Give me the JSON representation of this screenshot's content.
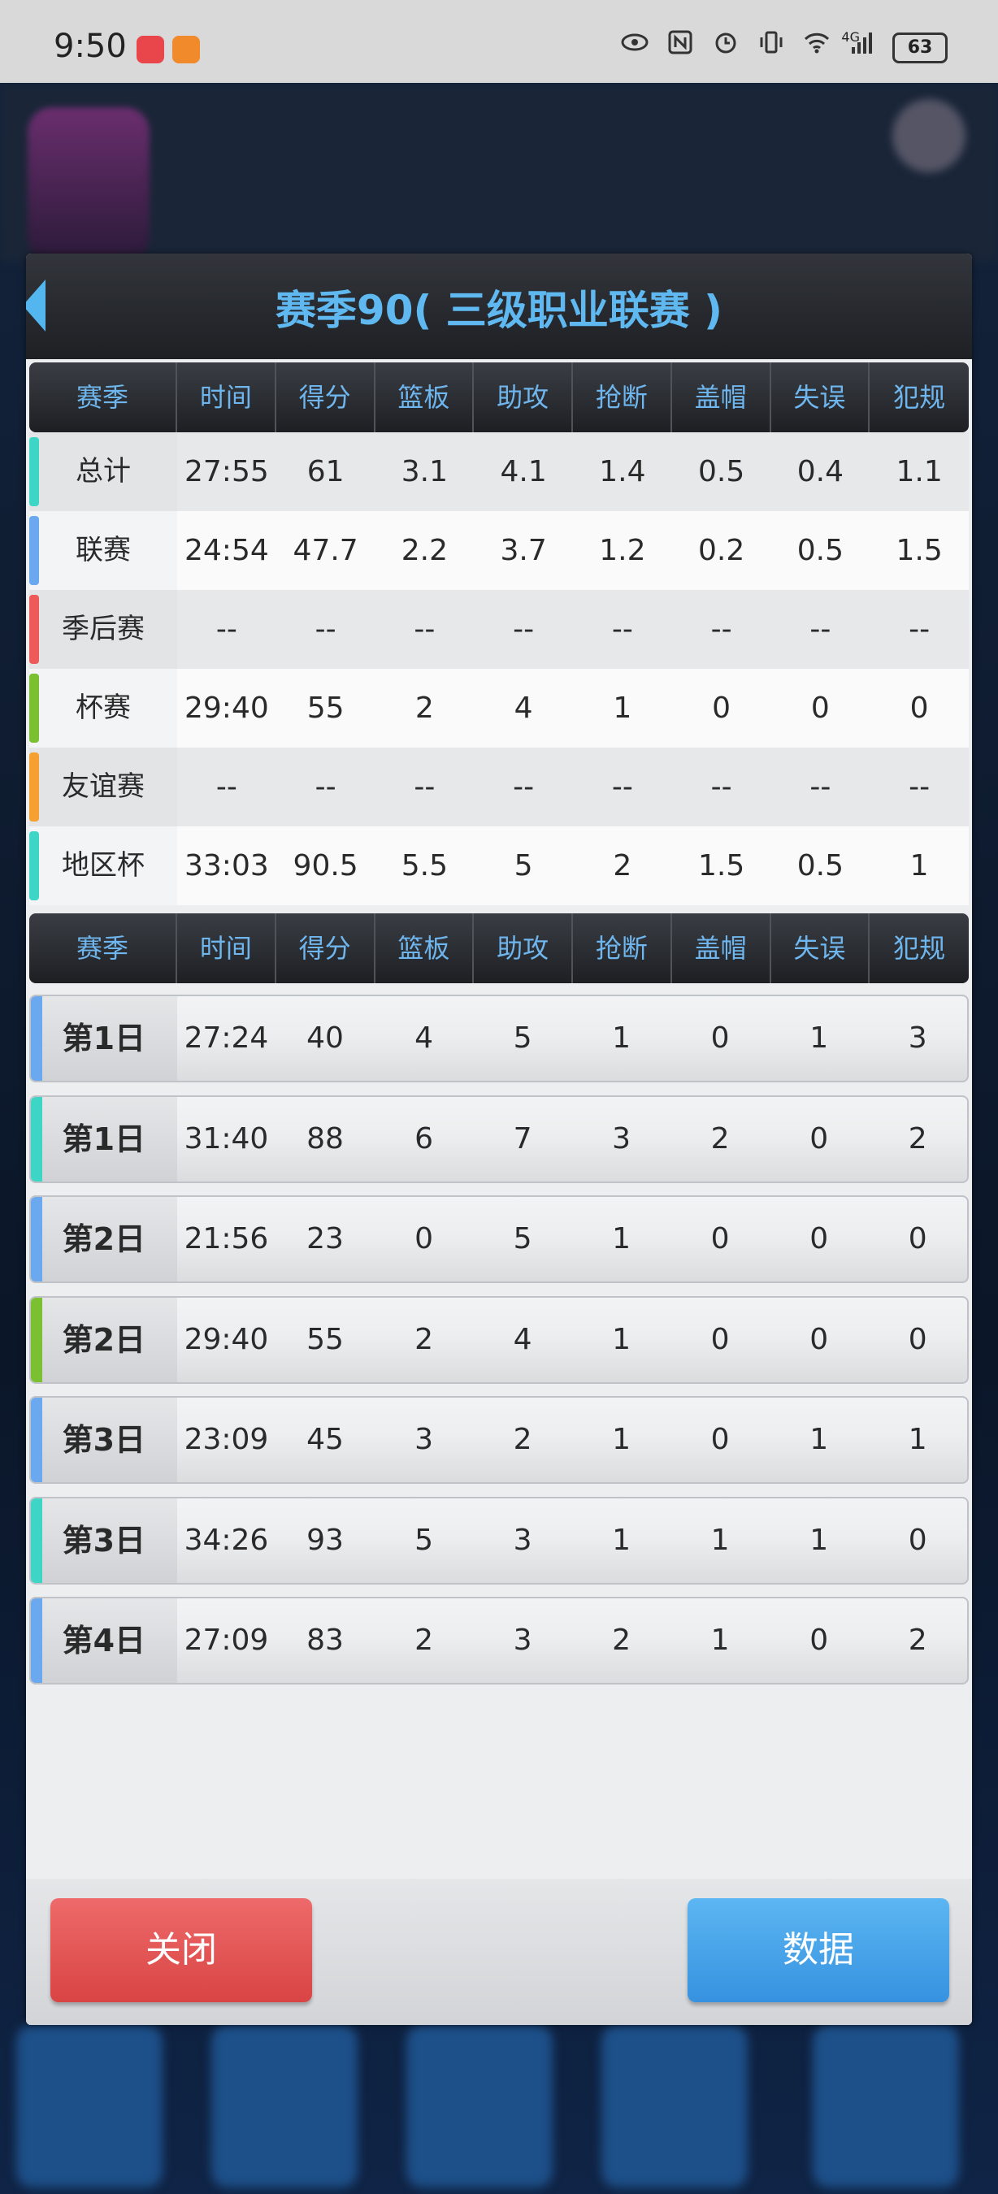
{
  "status_bar": {
    "time": "9:50",
    "signal_type": "4G",
    "battery": "63",
    "icons": [
      "eye-icon",
      "nfc-icon",
      "alarm-icon",
      "vibrate-icon",
      "wifi-icon",
      "signal-icon",
      "battery-icon"
    ]
  },
  "dialog": {
    "title": "赛季90( 三级职业联赛 )",
    "columns": [
      "赛季",
      "时间",
      "得分",
      "篮板",
      "助攻",
      "抢断",
      "盖帽",
      "失误",
      "犯规"
    ],
    "summary_rows": [
      {
        "label": "总计",
        "accent": "#3dd6c6",
        "values": [
          "27:55",
          "61",
          "3.1",
          "4.1",
          "1.4",
          "0.5",
          "0.4",
          "1.1"
        ]
      },
      {
        "label": "联赛",
        "accent": "#6aa8f0",
        "values": [
          "24:54",
          "47.7",
          "2.2",
          "3.7",
          "1.2",
          "0.2",
          "0.5",
          "1.5"
        ]
      },
      {
        "label": "季后赛",
        "accent": "#ee5a5a",
        "values": [
          "--",
          "--",
          "--",
          "--",
          "--",
          "--",
          "--",
          "--"
        ]
      },
      {
        "label": "杯赛",
        "accent": "#7ac030",
        "values": [
          "29:40",
          "55",
          "2",
          "4",
          "1",
          "0",
          "0",
          "0"
        ]
      },
      {
        "label": "友谊赛",
        "accent": "#f5a030",
        "values": [
          "--",
          "--",
          "--",
          "--",
          "--",
          "--",
          "--",
          "--"
        ]
      },
      {
        "label": "地区杯",
        "accent": "#3dd6c6",
        "values": [
          "33:03",
          "90.5",
          "5.5",
          "5",
          "2",
          "1.5",
          "0.5",
          "1"
        ]
      }
    ],
    "game_rows": [
      {
        "label": "第1日",
        "accent": "#6aa8f0",
        "values": [
          "27:24",
          "40",
          "4",
          "5",
          "1",
          "0",
          "1",
          "3"
        ]
      },
      {
        "label": "第1日",
        "accent": "#3dd6c6",
        "values": [
          "31:40",
          "88",
          "6",
          "7",
          "3",
          "2",
          "0",
          "2"
        ]
      },
      {
        "label": "第2日",
        "accent": "#6aa8f0",
        "values": [
          "21:56",
          "23",
          "0",
          "5",
          "1",
          "0",
          "0",
          "0"
        ]
      },
      {
        "label": "第2日",
        "accent": "#7ac030",
        "values": [
          "29:40",
          "55",
          "2",
          "4",
          "1",
          "0",
          "0",
          "0"
        ]
      },
      {
        "label": "第3日",
        "accent": "#6aa8f0",
        "values": [
          "23:09",
          "45",
          "3",
          "2",
          "1",
          "0",
          "1",
          "1"
        ]
      },
      {
        "label": "第3日",
        "accent": "#3dd6c6",
        "values": [
          "34:26",
          "93",
          "5",
          "3",
          "1",
          "1",
          "1",
          "0"
        ]
      },
      {
        "label": "第4日",
        "accent": "#6aa8f0",
        "values": [
          "27:09",
          "83",
          "2",
          "3",
          "2",
          "1",
          "0",
          "2"
        ]
      }
    ],
    "buttons": {
      "close": "关闭",
      "data": "数据"
    }
  }
}
